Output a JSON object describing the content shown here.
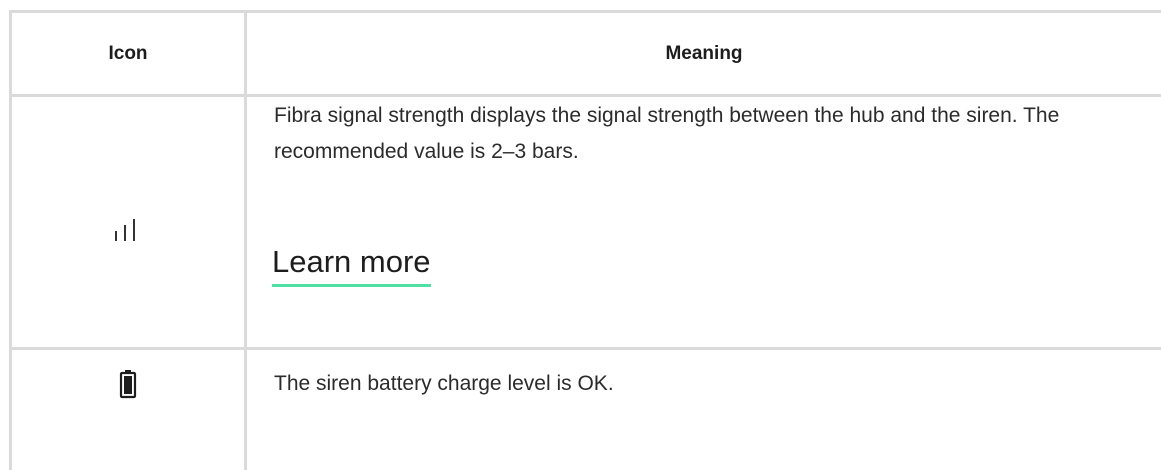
{
  "table": {
    "headers": {
      "icon": "Icon",
      "meaning": "Meaning"
    },
    "rows": [
      {
        "icon": "signal-strength-icon",
        "text": "Fibra signal strength displays the signal strength between the hub and the siren. The recommended value is 2–3 bars.",
        "link_label": "Learn more"
      },
      {
        "icon": "battery-full-icon",
        "text": "The siren battery charge level is OK."
      }
    ]
  },
  "colors": {
    "grid": "#dadada",
    "link_underline": "#4fe0a6",
    "text": "#1d1d1d"
  }
}
